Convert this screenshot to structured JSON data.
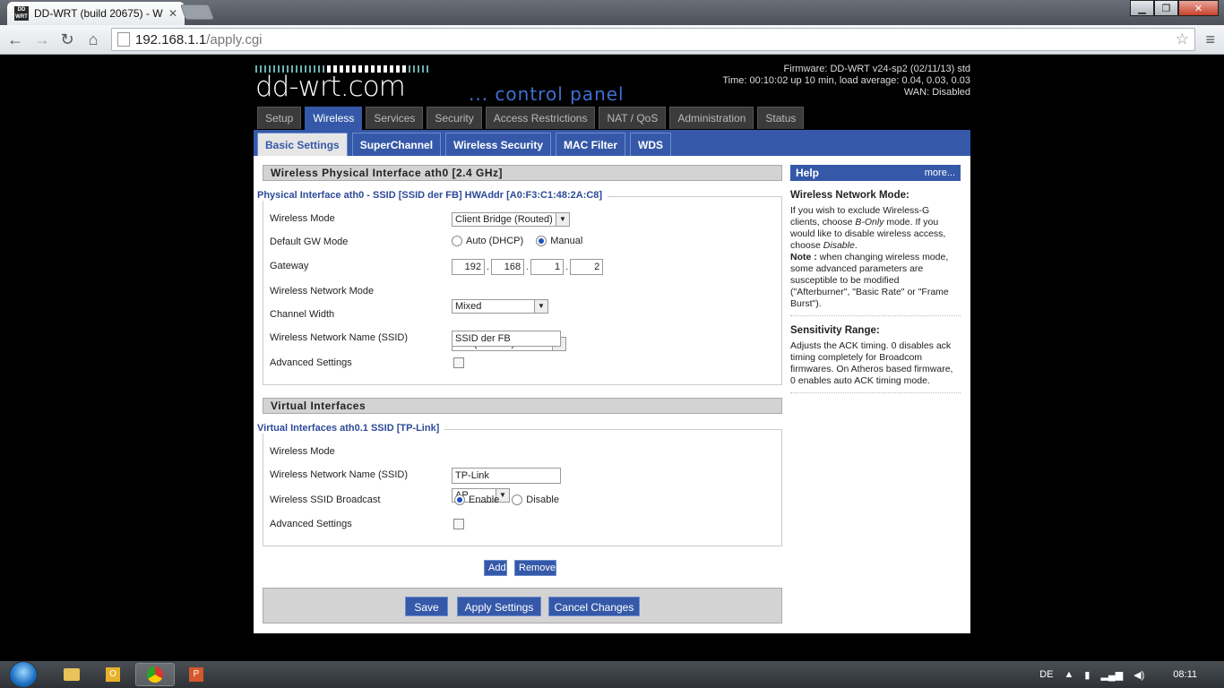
{
  "browser": {
    "tab_title": "DD-WRT (build 20675) - W",
    "favicon_text": "DD WRT",
    "url_host": "192.168.1.1",
    "url_path": "/apply.cgi"
  },
  "header": {
    "logo": "dd-wrt.com",
    "tagline": "... control panel",
    "firmware": "Firmware: DD-WRT v24-sp2 (02/11/13) std",
    "time": "Time: 00:10:02 up 10 min, load average: 0.04, 0.03, 0.03",
    "wan": "WAN: Disabled"
  },
  "main_tabs": [
    "Setup",
    "Wireless",
    "Services",
    "Security",
    "Access Restrictions",
    "NAT / QoS",
    "Administration",
    "Status"
  ],
  "main_tab_active": "Wireless",
  "sub_tabs": [
    "Basic Settings",
    "SuperChannel",
    "Wireless Security",
    "MAC Filter",
    "WDS"
  ],
  "sub_tab_active": "Basic Settings",
  "physical": {
    "section_title": "Wireless Physical Interface ath0 [2.4 GHz]",
    "legend": "Physical Interface ath0 - SSID [SSID der FB] HWAddr [A0:F3:C1:48:2A:C8]",
    "wireless_mode_label": "Wireless Mode",
    "wireless_mode_value": "Client Bridge (Routed)",
    "gw_mode_label": "Default GW Mode",
    "gw_auto": "Auto (DHCP)",
    "gw_manual": "Manual",
    "gateway_label": "Gateway",
    "gateway": [
      "192",
      "168",
      "1",
      "2"
    ],
    "net_mode_label": "Wireless Network Mode",
    "net_mode_value": "Mixed",
    "channel_width_label": "Channel Width",
    "channel_width_value": "Full (20 MHz)",
    "ssid_label": "Wireless Network Name (SSID)",
    "ssid_value": "SSID der FB",
    "advanced_label": "Advanced Settings"
  },
  "virtual": {
    "section_title": "Virtual Interfaces",
    "legend": "Virtual Interfaces ath0.1 SSID [TP-Link]",
    "wireless_mode_label": "Wireless Mode",
    "wireless_mode_value": "AP",
    "ssid_label": "Wireless Network Name (SSID)",
    "ssid_value": "TP-Link",
    "broadcast_label": "Wireless SSID Broadcast",
    "enable": "Enable",
    "disable": "Disable",
    "advanced_label": "Advanced Settings",
    "add": "Add",
    "remove": "Remove"
  },
  "buttons": {
    "save": "Save",
    "apply": "Apply Settings",
    "cancel": "Cancel Changes"
  },
  "help": {
    "title": "Help",
    "more": "more...",
    "s1_title": "Wireless Network Mode:",
    "s1_text_a": "If you wish to exclude Wireless-G clients, choose ",
    "s1_em1": "B-Only",
    "s1_text_b": " mode. If you would like to disable wireless access, choose ",
    "s1_em2": "Disable",
    "s1_text_c": ".",
    "s1_note_label": "Note :",
    "s1_note": " when changing wireless mode, some advanced parameters are susceptible to be modified (\"Afterburner\", \"Basic Rate\" or \"Frame Burst\").",
    "s2_title": "Sensitivity Range:",
    "s2_text": "Adjusts the ACK timing. 0 disables ack timing completely for Broadcom firmwares. On Atheros based firmware, 0 enables auto ACK timing mode."
  },
  "taskbar": {
    "lang": "DE",
    "clock": "08:11"
  }
}
